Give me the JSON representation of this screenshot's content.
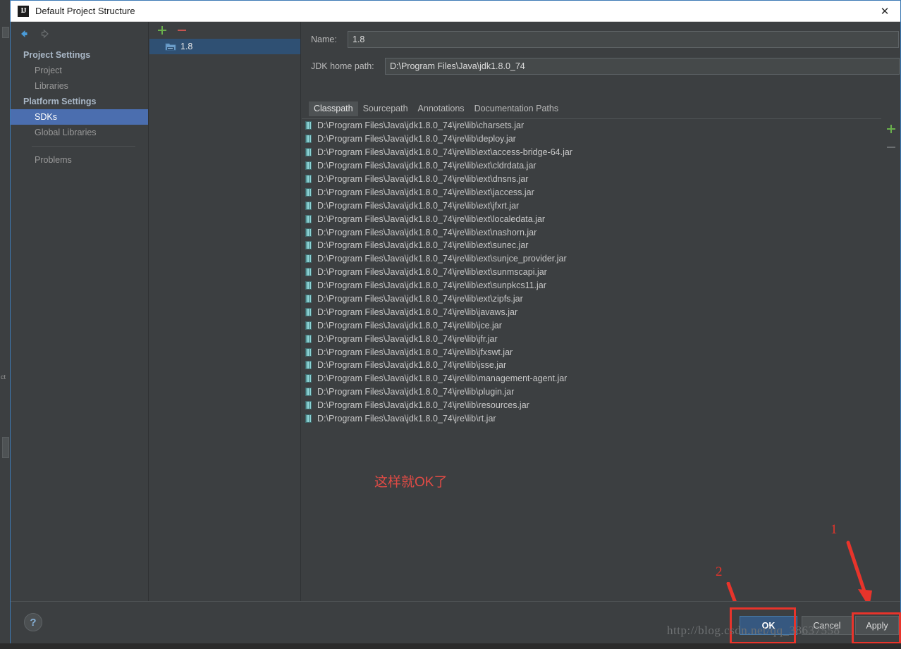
{
  "window": {
    "title": "Default Project Structure",
    "icon": "intellij-idea-icon",
    "close_label": "✕"
  },
  "sidebar": {
    "back_icon": "back-arrow-icon",
    "forward_icon": "forward-arrow-icon",
    "groups": [
      {
        "header": "Project Settings",
        "items": [
          "Project",
          "Libraries"
        ]
      },
      {
        "header": "Platform Settings",
        "items": [
          "SDKs",
          "Global Libraries"
        ]
      }
    ],
    "selected": "SDKs",
    "extra_item": "Problems"
  },
  "sdk_panel": {
    "add_label": "+",
    "remove_label": "−",
    "items": [
      {
        "name": "1.8",
        "icon": "jdk-folder-icon",
        "selected": true
      }
    ]
  },
  "detail": {
    "name_label": "Name:",
    "name_value": "1.8",
    "home_label": "JDK home path:",
    "home_value": "D:\\Program Files\\Java\\jdk1.8.0_74",
    "browse_label": "...",
    "tabs": [
      {
        "label": "Classpath",
        "active": true
      },
      {
        "label": "Sourcepath",
        "active": false
      },
      {
        "label": "Annotations",
        "active": false
      },
      {
        "label": "Documentation Paths",
        "active": false
      }
    ],
    "classpath": [
      "D:\\Program Files\\Java\\jdk1.8.0_74\\jre\\lib\\charsets.jar",
      "D:\\Program Files\\Java\\jdk1.8.0_74\\jre\\lib\\deploy.jar",
      "D:\\Program Files\\Java\\jdk1.8.0_74\\jre\\lib\\ext\\access-bridge-64.jar",
      "D:\\Program Files\\Java\\jdk1.8.0_74\\jre\\lib\\ext\\cldrdata.jar",
      "D:\\Program Files\\Java\\jdk1.8.0_74\\jre\\lib\\ext\\dnsns.jar",
      "D:\\Program Files\\Java\\jdk1.8.0_74\\jre\\lib\\ext\\jaccess.jar",
      "D:\\Program Files\\Java\\jdk1.8.0_74\\jre\\lib\\ext\\jfxrt.jar",
      "D:\\Program Files\\Java\\jdk1.8.0_74\\jre\\lib\\ext\\localedata.jar",
      "D:\\Program Files\\Java\\jdk1.8.0_74\\jre\\lib\\ext\\nashorn.jar",
      "D:\\Program Files\\Java\\jdk1.8.0_74\\jre\\lib\\ext\\sunec.jar",
      "D:\\Program Files\\Java\\jdk1.8.0_74\\jre\\lib\\ext\\sunjce_provider.jar",
      "D:\\Program Files\\Java\\jdk1.8.0_74\\jre\\lib\\ext\\sunmscapi.jar",
      "D:\\Program Files\\Java\\jdk1.8.0_74\\jre\\lib\\ext\\sunpkcs11.jar",
      "D:\\Program Files\\Java\\jdk1.8.0_74\\jre\\lib\\ext\\zipfs.jar",
      "D:\\Program Files\\Java\\jdk1.8.0_74\\jre\\lib\\javaws.jar",
      "D:\\Program Files\\Java\\jdk1.8.0_74\\jre\\lib\\jce.jar",
      "D:\\Program Files\\Java\\jdk1.8.0_74\\jre\\lib\\jfr.jar",
      "D:\\Program Files\\Java\\jdk1.8.0_74\\jre\\lib\\jfxswt.jar",
      "D:\\Program Files\\Java\\jdk1.8.0_74\\jre\\lib\\jsse.jar",
      "D:\\Program Files\\Java\\jdk1.8.0_74\\jre\\lib\\management-agent.jar",
      "D:\\Program Files\\Java\\jdk1.8.0_74\\jre\\lib\\plugin.jar",
      "D:\\Program Files\\Java\\jdk1.8.0_74\\jre\\lib\\resources.jar",
      "D:\\Program Files\\Java\\jdk1.8.0_74\\jre\\lib\\rt.jar"
    ],
    "list_add_label": "+",
    "list_remove_label": "−"
  },
  "annotations": {
    "note_cn": "这样就OK了",
    "marker_one": "1",
    "marker_two": "2",
    "color": "#e8342b"
  },
  "footer": {
    "help_label": "?",
    "buttons": [
      {
        "label": "OK",
        "style": "default"
      },
      {
        "label": "Cancel",
        "style": "normal"
      },
      {
        "label": "Apply",
        "style": "normal"
      }
    ]
  },
  "watermark": "http://blog.csdn.net/qq_38637558",
  "ide_background": {
    "sliver_text": "ct"
  }
}
